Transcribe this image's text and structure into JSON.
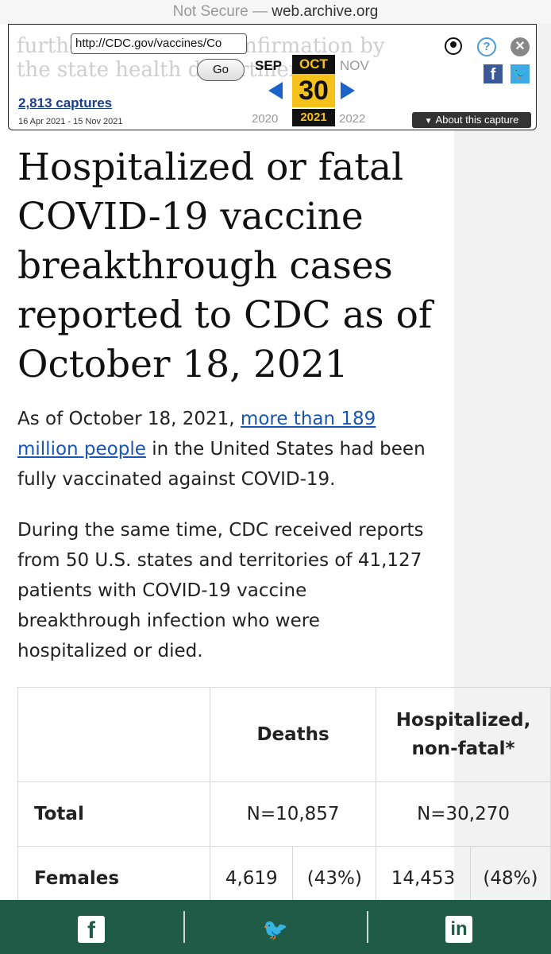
{
  "browser": {
    "not_secure": "Not Secure",
    "separator": " — ",
    "domain": "web.archive.org"
  },
  "wayback": {
    "ghost_text": "further review and confirmation by the state health department.",
    "url_value": "http://CDC.gov/vaccines/Co",
    "go_label": "Go",
    "captures": "2,813 captures",
    "date_range": "16 Apr 2021 - 15 Nov 2021",
    "months": {
      "prev": "SEP",
      "current": "OCT",
      "next": "NOV"
    },
    "day": "30",
    "years": {
      "prev": "2020",
      "current": "2021",
      "next": "2022"
    },
    "about_label": "About this capture",
    "icons": {
      "user": "user-icon",
      "help": "help-icon",
      "close": "close-icon",
      "facebook": "facebook-icon",
      "twitter": "twitter-icon"
    }
  },
  "article": {
    "title": "Hospitalized or fatal COVID-19 vaccine breakthrough cases reported to CDC as of October 18, 2021",
    "p1_prefix": "As of October 18, 2021, ",
    "p1_link": "more than 189 million people",
    "p1_suffix": " in the United States had been fully vaccinated against COVID-19.",
    "p2": "During the same time, CDC received reports from 50 U.S. states and territories of 41,127 patients with COVID-19 vaccine breakthrough infection who were hospitalized or died."
  },
  "table": {
    "headers": {
      "deaths": "Deaths",
      "hospitalized_line1": "Hospitalized,",
      "hospitalized_line2": "non-fatal*"
    },
    "rows": [
      {
        "label": "Total",
        "deaths": "N=10,857",
        "hospitalized": "N=30,270"
      },
      {
        "label": "Females",
        "deaths_n": "4,619",
        "deaths_pct": "(43%)",
        "hosp_n": "14,453",
        "hosp_pct": "(48%)"
      }
    ]
  },
  "share": {
    "facebook": "f",
    "twitter": "🐦",
    "linkedin": "in"
  },
  "colors": {
    "share_bar": "#1f5b46",
    "link": "#1a56b4",
    "wayback_yellow": "#f4c21b",
    "wayback_blue": "#1a63c9"
  }
}
